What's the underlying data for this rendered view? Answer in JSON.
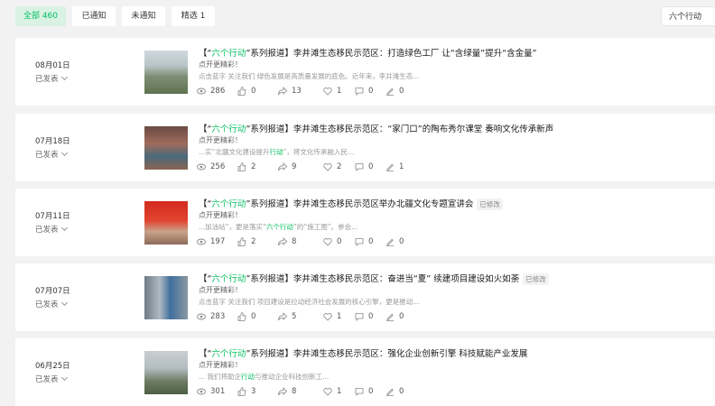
{
  "tabs": [
    {
      "label": "全部 460",
      "active": true
    },
    {
      "label": "已通知",
      "active": false
    },
    {
      "label": "未通知",
      "active": false
    },
    {
      "label": "精选 1",
      "active": false
    }
  ],
  "search": {
    "value": "六个行动"
  },
  "articles": [
    {
      "date": "08月01日",
      "status": "已发表",
      "title_pre": "【“",
      "title_hl": "六个行动",
      "title_post": "”系列报道】李井滩生态移民示范区：打造绿色工厂 让“含绿量”提升“含金量”",
      "edited": "",
      "subtitle": "点开更精彩！",
      "desc_pre": "点击蓝字 关注我们 绿色发展是高质量发展的底色。近年来，李井滩生态...",
      "desc_hl": "",
      "desc_post": "",
      "views": "286",
      "likes": "0",
      "shares": "13",
      "favorites": "1",
      "comments": "0",
      "rewards": "0"
    },
    {
      "date": "07月18日",
      "status": "已发表",
      "title_pre": "【“",
      "title_hl": "六个行动",
      "title_post": "”系列报道】李井滩生态移民示范区：“家门口”的陶布秀尔课堂  奏响文化传承新声",
      "edited": "",
      "subtitle": "点开更精彩！",
      "desc_pre": "...实“北疆文化建设提升",
      "desc_hl": "行动",
      "desc_post": "”，将文化传承融入民...",
      "views": "256",
      "likes": "2",
      "shares": "9",
      "favorites": "2",
      "comments": "0",
      "rewards": "1"
    },
    {
      "date": "07月11日",
      "status": "已发表",
      "title_pre": "【“",
      "title_hl": "六个行动",
      "title_post": "”系列报道】李井滩生态移民示范区举办北疆文化专题宣讲会",
      "edited": "已修改",
      "subtitle": "点开更精彩！",
      "desc_pre": "...加油站”，更是落实“",
      "desc_hl": "六个行动",
      "desc_post": "”的“施工图”。参会...",
      "views": "197",
      "likes": "2",
      "shares": "8",
      "favorites": "0",
      "comments": "0",
      "rewards": "0"
    },
    {
      "date": "07月07日",
      "status": "已发表",
      "title_pre": "【“",
      "title_hl": "六个行动",
      "title_post": "”系列报道】李井滩生态移民示范区：奋进当“夏” 续建项目建设如火如荼",
      "edited": "已修改",
      "subtitle": "点开更精彩！",
      "desc_pre": "点击蓝字 关注我们 项目建设是拉动经济社会发展的核心引擎，更是推动...",
      "desc_hl": "",
      "desc_post": "",
      "views": "283",
      "likes": "0",
      "shares": "5",
      "favorites": "1",
      "comments": "0",
      "rewards": "0"
    },
    {
      "date": "06月25日",
      "status": "已发表",
      "title_pre": "【“",
      "title_hl": "六个行动",
      "title_post": "”系列报道】李井滩生态移民示范区：强化企业创新引擎 科技赋能产业发展",
      "edited": "",
      "subtitle": "点开更精彩！",
      "desc_pre": "... 我们将助企",
      "desc_hl": "行动",
      "desc_post": "与推动企业科技创新工...",
      "views": "301",
      "likes": "3",
      "shares": "8",
      "favorites": "1",
      "comments": "0",
      "rewards": "0"
    }
  ],
  "colors": {
    "accent": "#07c160",
    "background": "#f2f2f2"
  }
}
